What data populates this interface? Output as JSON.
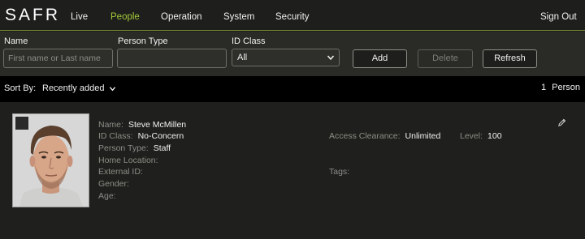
{
  "app": {
    "logo_text": "SAFR"
  },
  "nav": {
    "items": [
      {
        "label": "Live",
        "active": false
      },
      {
        "label": "People",
        "active": true
      },
      {
        "label": "Operation",
        "active": false
      },
      {
        "label": "System",
        "active": false
      },
      {
        "label": "Security",
        "active": false
      }
    ],
    "sign_out": "Sign Out"
  },
  "filters": {
    "name_label": "Name",
    "name_placeholder": "First name or Last name",
    "name_value": "",
    "person_type_label": "Person Type",
    "person_type_value": "",
    "id_class_label": "ID Class",
    "id_class_value": "All",
    "add_button": "Add",
    "delete_button": "Delete",
    "refresh_button": "Refresh"
  },
  "sort": {
    "label": "Sort By:",
    "value": "Recently added",
    "count": "1",
    "count_unit": "Person"
  },
  "person": {
    "name_label": "Name:",
    "name": "Steve McMillen",
    "id_class_label": "ID Class:",
    "id_class": "No-Concern",
    "person_type_label": "Person Type:",
    "person_type": "Staff",
    "home_location_label": "Home Location:",
    "home_location": "",
    "external_id_label": "External ID:",
    "external_id": "",
    "gender_label": "Gender:",
    "gender": "",
    "age_label": "Age:",
    "age": "",
    "access_clearance_label": "Access Clearance:",
    "access_clearance": "Unlimited",
    "level_label": "Level:",
    "level": "100",
    "tags_label": "Tags:",
    "tags": ""
  },
  "colors": {
    "accent": "#a5c83a",
    "background": "#1f201d",
    "sortbar": "#000000"
  }
}
